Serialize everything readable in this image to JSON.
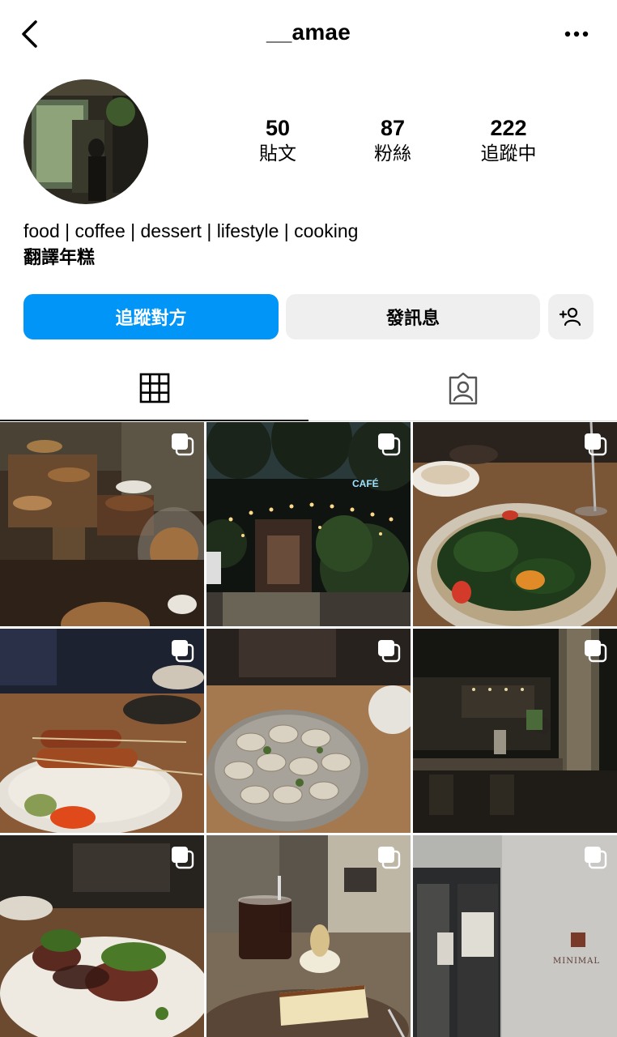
{
  "header": {
    "username": "__amae"
  },
  "profile": {
    "stats": [
      {
        "value": "50",
        "label": "貼文"
      },
      {
        "value": "87",
        "label": "粉絲"
      },
      {
        "value": "222",
        "label": "追蹤中"
      }
    ],
    "bio": "food | coffee | dessert | lifestyle | cooking",
    "name": "翻譯年糕"
  },
  "actions": {
    "follow": "追蹤對方",
    "message": "發訊息"
  },
  "brand_text": "MINIMAL",
  "colors": {
    "accent": "#0095f6",
    "secondary_button": "#efefef"
  },
  "icons": [
    "back-arrow-icon",
    "more-dots-icon",
    "add-person-icon",
    "grid-icon",
    "tagged-icon",
    "multiple-posts-icon"
  ],
  "posts": [
    {
      "name": "post-bakery-display"
    },
    {
      "name": "post-cafe-night"
    },
    {
      "name": "post-salad-bowl"
    },
    {
      "name": "post-skewers"
    },
    {
      "name": "post-dumplings"
    },
    {
      "name": "post-dark-bar"
    },
    {
      "name": "post-steak"
    },
    {
      "name": "post-coffee-cheesecake"
    },
    {
      "name": "post-minimal-storefront"
    }
  ]
}
